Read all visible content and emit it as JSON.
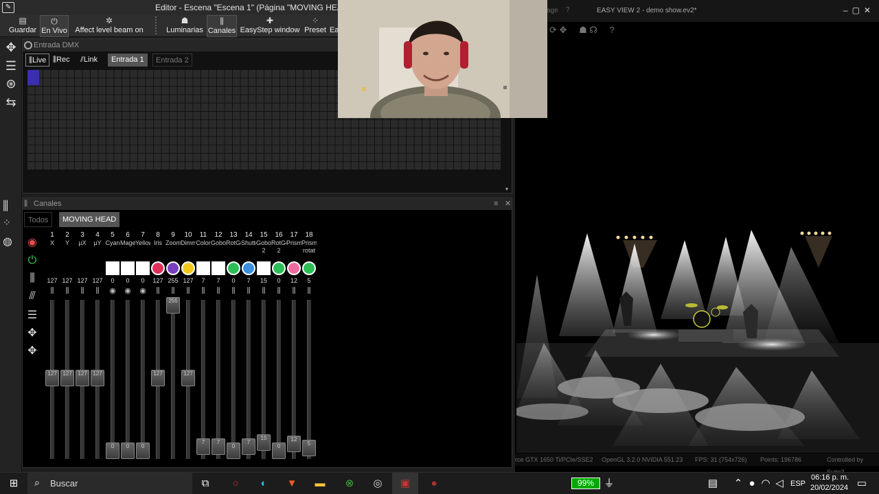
{
  "editor": {
    "title": "Editor - Escena \"Escena 1\" (Página \"MOVING HEAD\")",
    "toolbar": [
      {
        "label": "Guardar",
        "icon": "save-icon"
      },
      {
        "label": "En Vivo",
        "icon": "power-icon"
      },
      {
        "label": "Affect level beam on",
        "icon": "beam-icon"
      },
      {
        "label": "Luminarias",
        "icon": "fixture-icon"
      },
      {
        "label": "Canales",
        "icon": "faders-icon"
      },
      {
        "label": "EasyStep window",
        "icon": "step-icon"
      },
      {
        "label": "Preset",
        "icon": "preset-icon"
      },
      {
        "label": "Ea",
        "icon": ""
      }
    ],
    "dmx": {
      "title": "Entrada DMX",
      "live": "Live",
      "rec": "Rec",
      "link": "Link",
      "tabs": [
        "Entrada 1",
        "Entrada 2"
      ]
    },
    "canales": {
      "title": "Canales",
      "tabs": [
        "Todos",
        "MOVING HEAD"
      ],
      "channels": [
        {
          "num": "1",
          "name": "X",
          "name2": "",
          "value": "127",
          "level": 127,
          "swatch": ""
        },
        {
          "num": "2",
          "name": "Y",
          "name2": "",
          "value": "127",
          "level": 127,
          "swatch": ""
        },
        {
          "num": "3",
          "name": "µX",
          "name2": "",
          "value": "127",
          "level": 127,
          "swatch": ""
        },
        {
          "num": "4",
          "name": "µY",
          "name2": "",
          "value": "127",
          "level": 127,
          "swatch": ""
        },
        {
          "num": "5",
          "name": "Cyan",
          "name2": "",
          "value": "0",
          "level": 0,
          "swatch": "#ffffff"
        },
        {
          "num": "6",
          "name": "Magenta",
          "name2": "",
          "value": "0",
          "level": 0,
          "swatch": "#ffffff"
        },
        {
          "num": "7",
          "name": "Yellow",
          "name2": "",
          "value": "0",
          "level": 0,
          "swatch": "#ffffff"
        },
        {
          "num": "8",
          "name": "Iris",
          "name2": "",
          "value": "127",
          "level": 127,
          "swatch": "#e0305a"
        },
        {
          "num": "9",
          "name": "Zoom",
          "name2": "",
          "value": "255",
          "level": 255,
          "swatch": "#7a3fc0"
        },
        {
          "num": "10",
          "name": "Dimmer",
          "name2": "",
          "value": "127",
          "level": 127,
          "swatch": "#f2c81c"
        },
        {
          "num": "11",
          "name": "Color",
          "name2": "",
          "value": "7",
          "level": 7,
          "swatch": "#ffffff"
        },
        {
          "num": "12",
          "name": "Gobo",
          "name2": "",
          "value": "7",
          "level": 7,
          "swatch": "#ffffff"
        },
        {
          "num": "13",
          "name": "RotGobo",
          "name2": "",
          "value": "0",
          "level": 0,
          "swatch": "#2bbf55"
        },
        {
          "num": "14",
          "name": "Shutter",
          "name2": "",
          "value": "7",
          "level": 7,
          "swatch": "#3a8fe0"
        },
        {
          "num": "15",
          "name": "Gobo",
          "name2": "2",
          "value": "15",
          "level": 15,
          "swatch": "#ffffff"
        },
        {
          "num": "16",
          "name": "RotGobo",
          "name2": "2",
          "value": "0",
          "level": 0,
          "swatch": "#2bbf55"
        },
        {
          "num": "17",
          "name": "Prism",
          "name2": "",
          "value": "12",
          "level": 12,
          "swatch": "#f06aa0"
        },
        {
          "num": "18",
          "name": "Prism",
          "name2": "rotat",
          "value": "5",
          "level": 5,
          "swatch": "#2bbf55"
        }
      ]
    }
  },
  "easyview": {
    "title": "EASY VIEW 2 - demo show.ev2*",
    "menu_fragment": "age",
    "status": {
      "gpu": "rce GTX 1650 Ti/PCIe/SSE2",
      "opengl": "OpenGL  3.2.0 NVIDIA 551.23",
      "fps": "FPS:  31 (754x726)",
      "points": "Points:  196786",
      "controlled": "Controlled by Suite3"
    }
  },
  "taskbar": {
    "search": "Buscar",
    "battery": "99%",
    "lang": "ESP",
    "time": "06:16 p. m.",
    "date": "20/02/2024"
  }
}
